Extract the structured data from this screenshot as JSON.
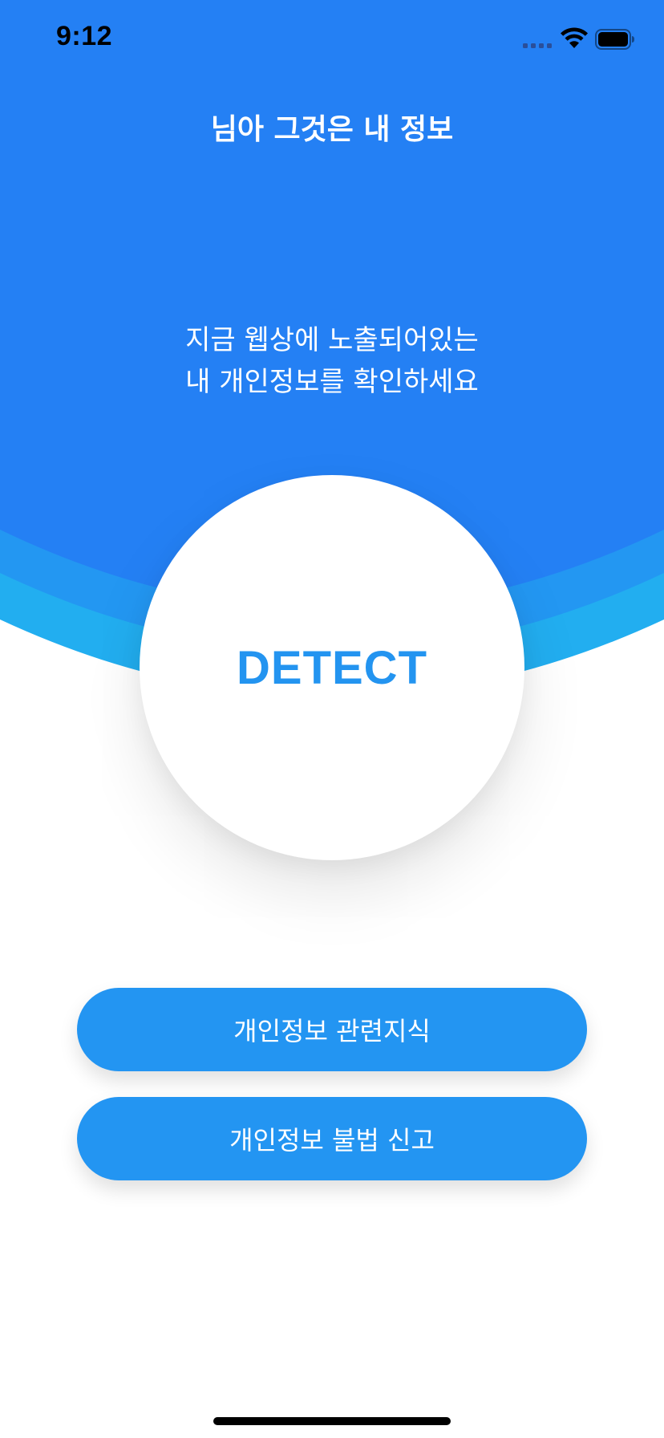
{
  "status_bar": {
    "time": "9:12",
    "signal_icon": "cellular-signal-icon",
    "wifi_icon": "wifi-icon",
    "battery_icon": "battery-icon"
  },
  "header": {
    "title": "님아 그것은 내 정보"
  },
  "intro": {
    "line1": "지금 웹상에 노출되어있는",
    "line2": "내 개인정보를 확인하세요"
  },
  "detect": {
    "label": "DETECT"
  },
  "buttons": [
    {
      "label": "개인정보 관련지식"
    },
    {
      "label": "개인정보 불법 신고"
    }
  ],
  "colors": {
    "primary_blue": "#2480F4",
    "wave_mid": "#2397F2",
    "wave_light": "#22AEF0",
    "button_blue": "#2395F2",
    "detect_text": "#2394F0"
  }
}
